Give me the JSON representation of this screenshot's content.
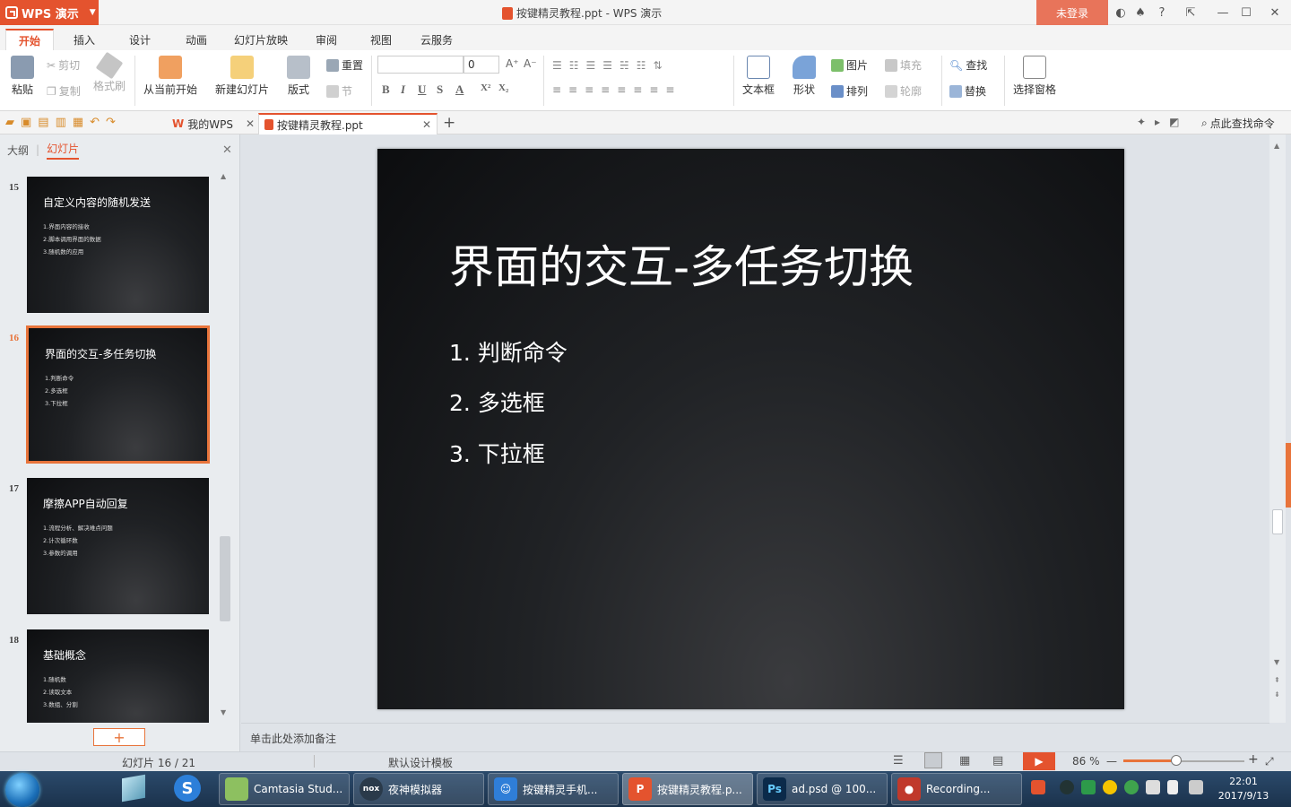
{
  "titlebar": {
    "app_name": "WPS 演示",
    "doc_title": "按键精灵教程.ppt - WPS 演示",
    "login": "未登录",
    "help": "?"
  },
  "tabs": [
    "开始",
    "插入",
    "设计",
    "动画",
    "幻灯片放映",
    "审阅",
    "视图",
    "云服务"
  ],
  "ribbon": {
    "paste": "粘贴",
    "cut": "剪切",
    "copy": "复制",
    "format_painter": "格式刷",
    "from_current": "从当前开始",
    "new_slide": "新建幻灯片",
    "layout": "版式",
    "reset": "重置",
    "section": "节",
    "font_size": "0",
    "textbox": "文本框",
    "shape": "形状",
    "picture": "图片",
    "fill": "填充",
    "arrange": "排列",
    "outline": "轮廓",
    "find": "查找",
    "replace": "替换",
    "select_pane": "选择窗格",
    "bold": "B",
    "italic": "I",
    "underline": "U",
    "strike": "S",
    "font_color": "A",
    "superscript": "X²",
    "subscript": "X₂"
  },
  "quickbar": {
    "my_wps": "我的WPS",
    "doc_tab": "按键精灵教程.ppt",
    "search_cmd": "点此查找命令"
  },
  "pane": {
    "outline_tab": "大纲",
    "slides_tab": "幻灯片"
  },
  "thumbnails": [
    {
      "num": "15",
      "title": "自定义内容的随机发送",
      "lines": [
        "1.界面内容的接收",
        "2.脚本调用界面的数据",
        "3.随机数的应用"
      ]
    },
    {
      "num": "16",
      "title": "界面的交互-多任务切换",
      "lines": [
        "1.判断命令",
        "2.多选框",
        "3.下拉框"
      ]
    },
    {
      "num": "17",
      "title": "摩擦APP自动回复",
      "lines": [
        "1.流程分析、解决难点问题",
        "2.计次循环数",
        "3.参数的调用"
      ]
    },
    {
      "num": "18",
      "title": "基础概念",
      "lines": [
        "1.随机数",
        "2.读取文本",
        "3.数组、分割"
      ]
    }
  ],
  "slide": {
    "title": "界面的交互-多任务切换",
    "bullets": [
      "1. 判断命令",
      "2. 多选框",
      "3. 下拉框"
    ]
  },
  "notes_placeholder": "单击此处添加备注",
  "status": {
    "slide_counter": "幻灯片 16 / 21",
    "template": "默认设计模板",
    "zoom": "86 %",
    "zoom_level": 0.44
  },
  "taskbar": {
    "items": [
      "Camtasia Stud...",
      "夜神模拟器",
      "按键精灵手机...",
      "按键精灵教程.p...",
      "ad.psd @ 100...",
      "Recording..."
    ],
    "time": "22:01",
    "date": "2017/9/13"
  },
  "colors": {
    "accent": "#e4532e",
    "selection": "#e8743b",
    "slide_bg": "#16171a"
  }
}
